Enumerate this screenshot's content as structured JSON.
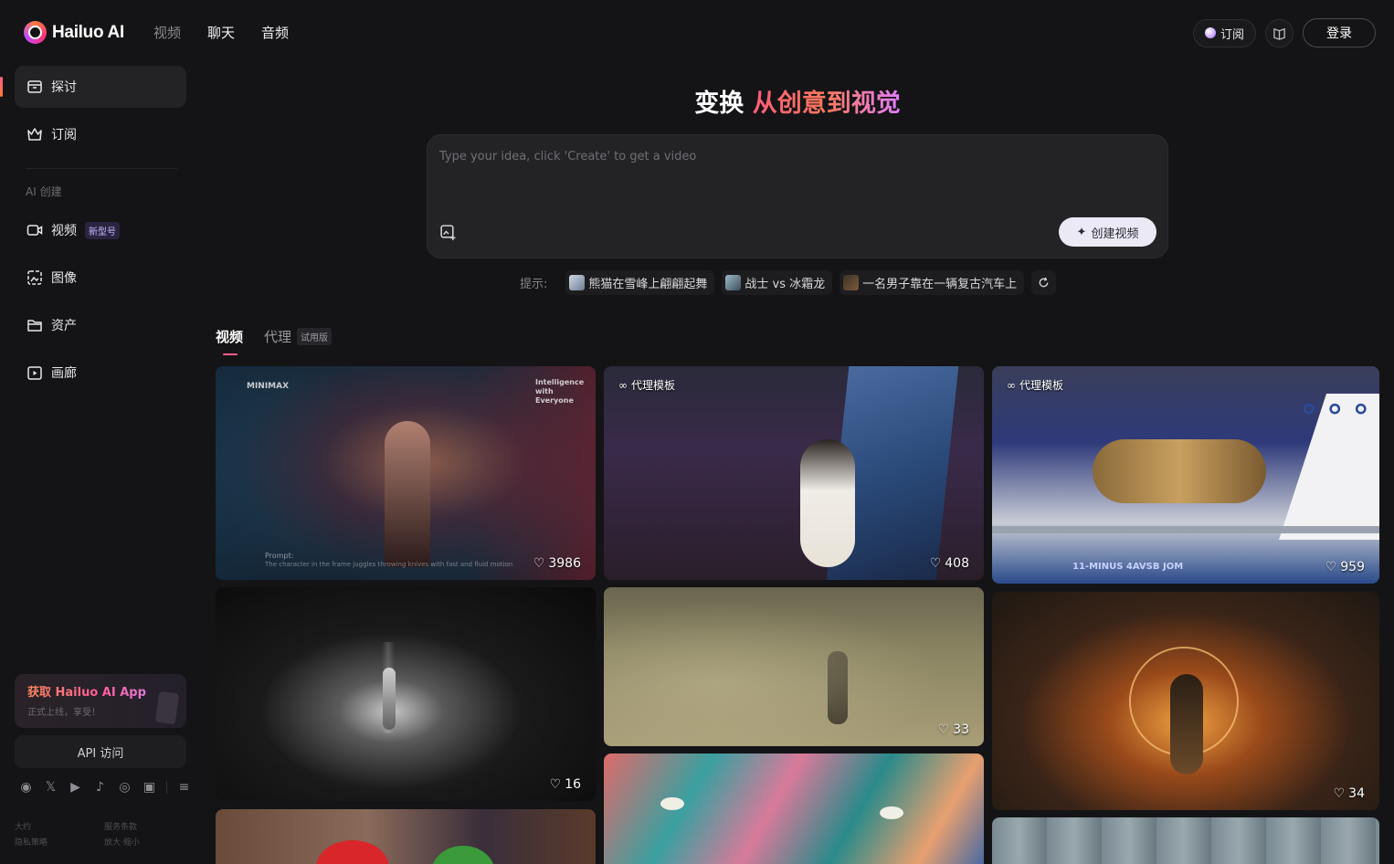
{
  "brand": {
    "logo_text": "Hailuo AI"
  },
  "top_nav": {
    "items": [
      "视频",
      "聊天",
      "音频"
    ]
  },
  "header": {
    "subscribe_label": "订阅",
    "login_label": "登录"
  },
  "sidebar": {
    "items": [
      {
        "label": "探讨",
        "icon": "explore-icon"
      },
      {
        "label": "订阅",
        "icon": "crown-icon"
      }
    ],
    "section_title": "AI 创建",
    "create_items": [
      {
        "label": "视频",
        "badge": "新型号",
        "icon": "video-icon"
      },
      {
        "label": "图像",
        "icon": "image-icon"
      },
      {
        "label": "资产",
        "icon": "folder-icon"
      },
      {
        "label": "画廊",
        "icon": "gallery-icon"
      }
    ],
    "app_card": {
      "title": "获取 Hailuo AI App",
      "subtitle": "正式上线，享受！"
    },
    "api_label": "API 访问",
    "footer_links": [
      "大约",
      "服务条款",
      "隐私策略",
      "放大·缩小"
    ]
  },
  "hero": {
    "title_plain": "变换 ",
    "title_gradient": "从创意到视觉"
  },
  "prompt": {
    "placeholder": "Type your idea, click 'Create' to get a video",
    "create_label": "创建视频"
  },
  "tips": {
    "label": "提示:",
    "chips": [
      "熊猫在雪峰上翩翩起舞",
      "战士 vs 冰霜龙",
      "一名男子靠在一辆复古汽车上"
    ]
  },
  "tabs": {
    "video": "视频",
    "agent": "代理",
    "agent_badge": "试用版"
  },
  "gallery": {
    "agent_tag": "代理模板",
    "cards": [
      {
        "likes": "3986",
        "watermark": "MINIMAX",
        "overlay": "Intelligence with Everyone",
        "prompt_label": "Prompt:",
        "prompt_text": "The character in the frame juggles throwing knives with fast and fluid motion"
      },
      {
        "likes": "408"
      },
      {
        "likes": "959",
        "banner": "11-MINUS 4AVSB JOM"
      },
      {
        "likes": "16"
      },
      {
        "likes": "33"
      },
      {
        "likes": "34"
      }
    ]
  }
}
